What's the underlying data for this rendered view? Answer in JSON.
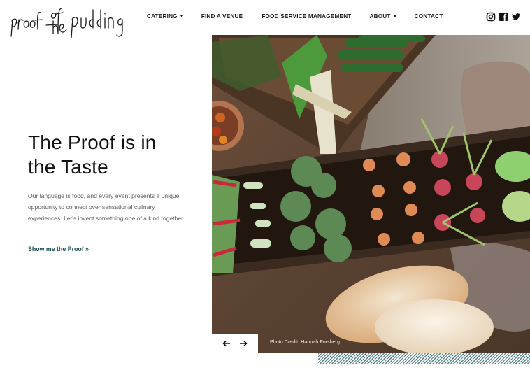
{
  "brand": {
    "logo_text": "proof of the pudding",
    "logo_icon": "handwritten-logo"
  },
  "nav": {
    "items": [
      {
        "label": "CATERING",
        "has_dropdown": true
      },
      {
        "label": "FIND A VENUE",
        "has_dropdown": false
      },
      {
        "label": "FOOD SERVICE MANAGEMENT",
        "has_dropdown": false
      },
      {
        "label": "ABOUT",
        "has_dropdown": true
      },
      {
        "label": "CONTACT",
        "has_dropdown": false
      }
    ]
  },
  "social": {
    "icons": [
      "instagram-icon",
      "facebook-icon",
      "twitter-icon"
    ]
  },
  "hero": {
    "title_line1": "The Proof is in",
    "title_line2": "the Taste",
    "body": "Our language is food, and every event presents a unique opportunity to connect over sensational culinary experiences. Let’s invent something one of a kind together.",
    "cta": "Show me the Proof »"
  },
  "slider": {
    "prev_icon": "arrow-left-icon",
    "next_icon": "arrow-right-icon",
    "photo_credit": "Photo Credit: Hannah Forsberg",
    "photo_subject": "Vegetables growing in wooden planter with bread loaves"
  },
  "colors": {
    "accent": "#1e4f52",
    "hatch": "#4e7f86",
    "text": "#111111",
    "body_text": "#5d5d5d"
  }
}
